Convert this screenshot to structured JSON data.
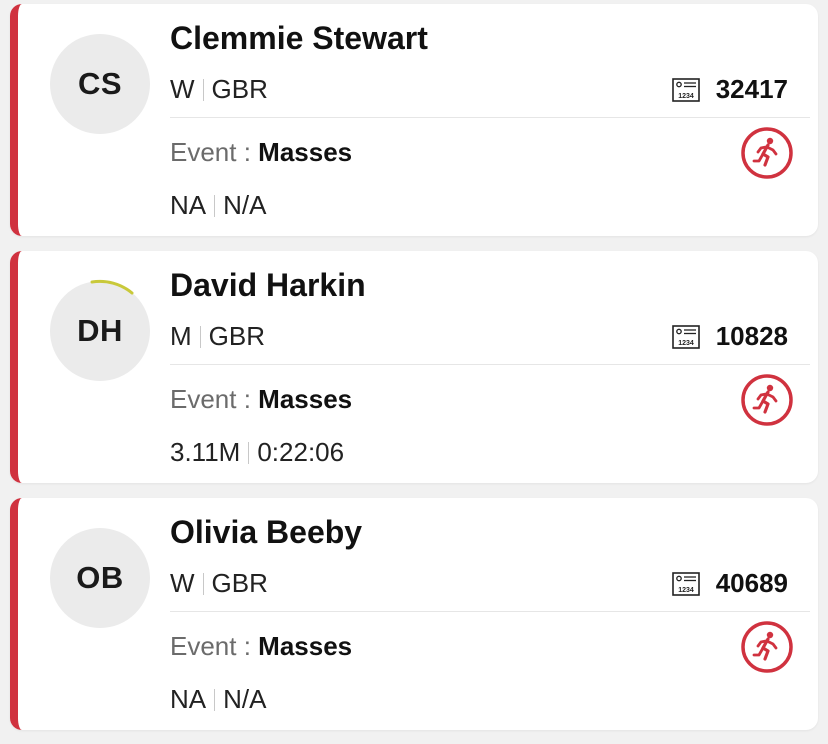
{
  "colors": {
    "accent": "#d0323f",
    "progress_arc": "#c9c93a",
    "avatar_bg": "#ebebeb"
  },
  "icons": {
    "bib": "bib-number-icon",
    "status": "running-person-icon"
  },
  "athletes": [
    {
      "initials": "CS",
      "name": "Clemmie Stewart",
      "gender": "W",
      "country": "GBR",
      "bib": "32417",
      "event_label": "Event :",
      "event": "Masses",
      "distance": "NA",
      "time": "N/A"
    },
    {
      "initials": "DH",
      "name": "David Harkin",
      "gender": "M",
      "country": "GBR",
      "bib": "10828",
      "event_label": "Event :",
      "event": "Masses",
      "distance": "3.11M",
      "time": "0:22:06"
    },
    {
      "initials": "OB",
      "name": "Olivia Beeby",
      "gender": "W",
      "country": "GBR",
      "bib": "40689",
      "event_label": "Event :",
      "event": "Masses",
      "distance": "NA",
      "time": "N/A"
    }
  ]
}
